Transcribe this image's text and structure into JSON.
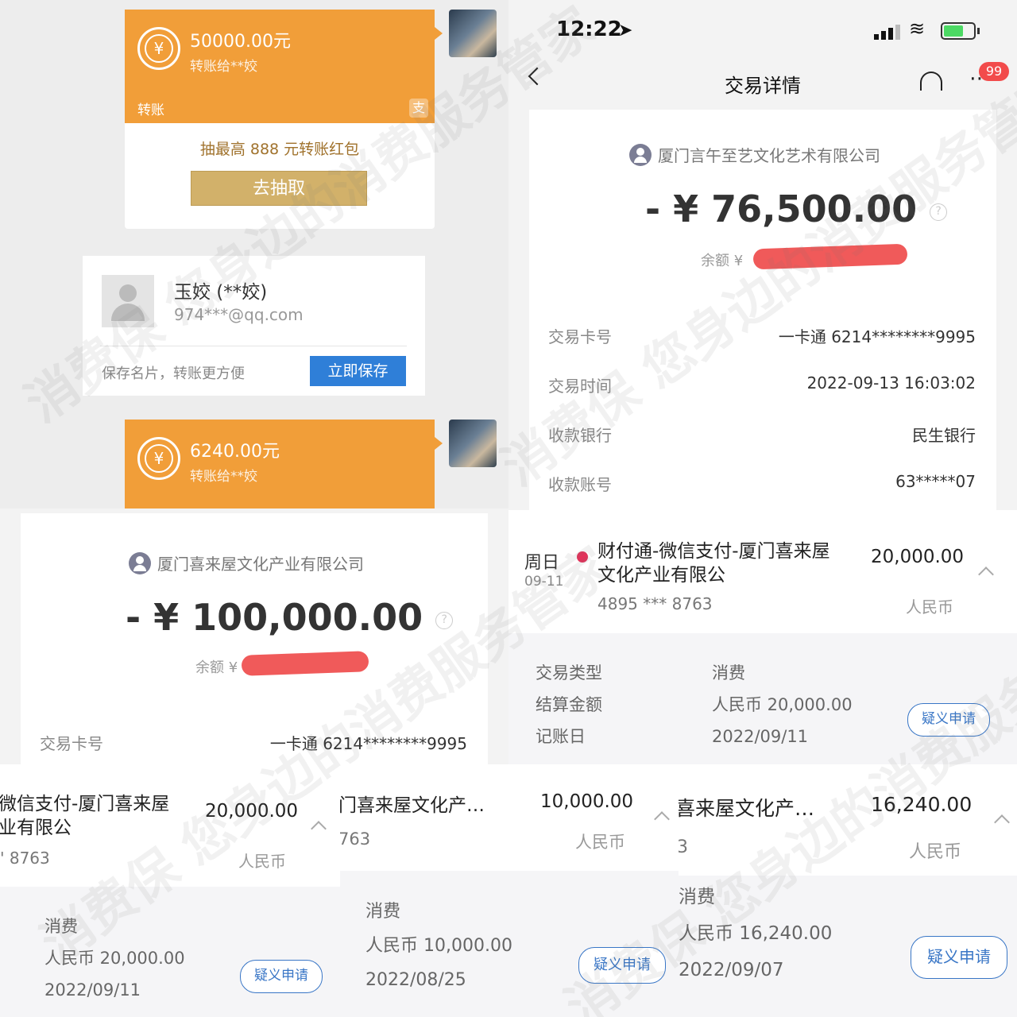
{
  "chat": {
    "transfer1": {
      "amount": "50000.00元",
      "to": "转账给**姣",
      "label": "转账",
      "brand": "支"
    },
    "promo": {
      "text": "抽最高 888 元转账红包",
      "button": "去抽取"
    },
    "contact": {
      "name": "玉姣 (**姣)",
      "email": "974***@qq.com",
      "hint": "保存名片，转账更方便",
      "save_button": "立即保存"
    },
    "transfer2": {
      "amount": "6240.00元",
      "to": "转账给**姣"
    }
  },
  "detail": {
    "status_time": "12:22",
    "title": "交易详情",
    "badge": "99",
    "company": "厦门言午至艺文化艺术有限公司",
    "amount": "- ¥ 76,500.00",
    "balance_label": "余额 ¥",
    "rows": [
      {
        "label": "交易卡号",
        "value": "一卡通 6214********9995"
      },
      {
        "label": "交易时间",
        "value": "2022-09-13 16:03:02"
      },
      {
        "label": "收款银行",
        "value": "民生银行"
      },
      {
        "label": "收款账号",
        "value": "63*****07"
      }
    ]
  },
  "weekday_item": {
    "day": "周日",
    "date": "09-11",
    "title_line1": "财付通-微信支付-厦门喜来屋",
    "title_line2": "文化产业有限公",
    "card": "4895 *** 8763",
    "amount": "20,000.00",
    "currency": "人民币",
    "detail_labels": [
      "交易类型",
      "结算金额",
      "记账日"
    ],
    "detail_values": [
      "消费",
      "人民币 20,000.00",
      "2022/09/11"
    ],
    "dispute": "疑义申请"
  },
  "left_mid": {
    "company": "厦门喜来屋文化产业有限公司",
    "amount": "- ¥ 100,000.00",
    "balance_label": "余额 ¥",
    "card_label": "交易卡号",
    "card_value": "一卡通 6214********9995"
  },
  "bottom": [
    {
      "title_line1": "微信支付-厦门喜来屋",
      "title_line2": "业有限公",
      "card": "' 8763",
      "amount": "20,000.00",
      "currency": "人民币",
      "type": "消费",
      "settle": "人民币 20,000.00",
      "date": "2022/09/11",
      "dispute": "疑义申请"
    },
    {
      "title_line1": "门喜来屋文化产…",
      "card": "763",
      "amount": "10,000.00",
      "currency": "人民币",
      "type": "消费",
      "settle": "人民币 10,000.00",
      "date": "2022/08/25",
      "dispute": "疑义申请"
    },
    {
      "title_line1": "喜来屋文化产…",
      "card": "3",
      "amount": "16,240.00",
      "currency": "人民币",
      "type": "消费",
      "settle": "人民币 16,240.00",
      "date": "2022/09/07",
      "dispute": "疑义申请"
    }
  ],
  "watermark": "消费保 您身边的消费服务管家",
  "colors": {
    "orange": "#f19e39",
    "gold_button": "#d2b16a",
    "blue": "#2f7fd8",
    "red": "#f05a5a"
  }
}
